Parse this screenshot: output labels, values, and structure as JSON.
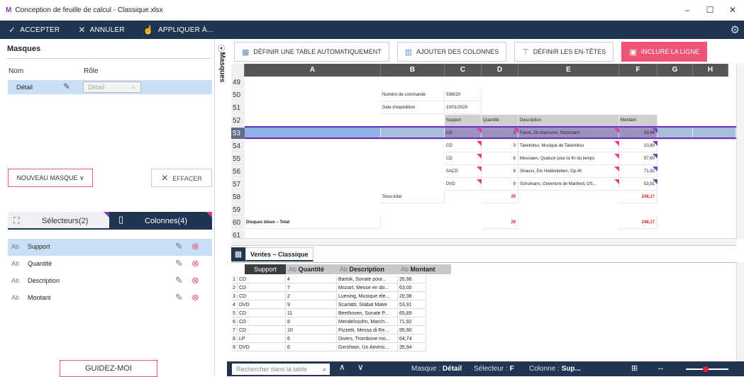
{
  "window": {
    "title": "Conception de feuille de calcul - Classique.xlsx",
    "logo": "M",
    "minimize": "–",
    "maximize": "☐",
    "close": "✕"
  },
  "toolbar": {
    "accept": "ACCEPTER",
    "cancel": "ANNULER",
    "apply": "APPLIQUER À..."
  },
  "masks": {
    "title": "Masques",
    "col_name": "Nom",
    "col_role": "Rôle",
    "rows": [
      {
        "name": "Détail",
        "role": "Détail"
      }
    ],
    "new_button": "NOUVEAU MASQUE ∨",
    "clear_button": "EFFACER",
    "vertical_label": "Masques"
  },
  "tabs": {
    "selectors": "Sélecteurs(2)",
    "columns": "Colonnes(4)"
  },
  "columns_list": [
    {
      "type": "Ab",
      "name": "Support"
    },
    {
      "type": "Ab",
      "name": "Quantité"
    },
    {
      "type": "Ab",
      "name": "Description"
    },
    {
      "type": "Ab",
      "name": "Montant"
    }
  ],
  "guide_button": "GUIDEZ-MOI",
  "sheet_toolbar": {
    "auto_table": "DÉFINIR UNE TABLE AUTOMATIQUEMENT",
    "add_columns": "AJOUTER DES COLONNES",
    "headers": "DÉFINIR LES EN-TÊTES",
    "include_row": "INCLURE LA LIGNE"
  },
  "grid": {
    "columns": [
      "A",
      "B",
      "C",
      "D",
      "E",
      "F",
      "G",
      "H"
    ],
    "rows": [
      "49",
      "50",
      "51",
      "52",
      "53",
      "54",
      "55",
      "56",
      "57",
      "58",
      "59",
      "60",
      "61"
    ],
    "active_row": "53",
    "cells": {
      "order_label": "Numéro de commande",
      "order_value": "536020",
      "ship_label": "Date d'expédition",
      "ship_value": "10/01/2020",
      "h_support": "Support",
      "h_qty": "Quantité",
      "h_desc": "Description",
      "h_amount": "Montant",
      "r53": [
        "CD",
        "3",
        "Faure, 28 chansons, Stulzmann",
        "53,94"
      ],
      "r54": [
        "CD",
        "3",
        "Takemitsu, Musique de Takemitsu",
        "10,80"
      ],
      "r55": [
        "CD",
        "6",
        "Messiaen, Quatuor pour la fin du temps",
        "57,60"
      ],
      "r56": [
        "SACD",
        "8",
        "Strauss, Ein Heldenleben, Op.40",
        "71,92"
      ],
      "r57": [
        "DVD",
        "9",
        "Schumann, Ouverture de Manfred, OS...",
        "53,91"
      ],
      "subtotal_label": "Sous-total",
      "subtotal_qty": "29",
      "subtotal_amount": "248,17",
      "total_label": "Disques bleus – Total",
      "total_qty": "29",
      "total_amount": "248,17"
    }
  },
  "sheet_tab": "Ventes – Classique",
  "preview": {
    "headers": [
      "Support",
      "Quantité",
      "Description",
      "Montant"
    ],
    "header_types": [
      "",
      "Ab",
      "Ab",
      "Ab"
    ],
    "rows": [
      [
        "1",
        "CD",
        "4",
        "Bartok, Sonate pour...",
        "35,96"
      ],
      [
        "2",
        "CD",
        "7",
        "Mozart, Messe en do...",
        "63,00"
      ],
      [
        "3",
        "CD",
        "2",
        "Luening, Musique éle...",
        "20,38"
      ],
      [
        "4",
        "DVD",
        "9",
        "Scarlatti, Stabat Mater",
        "53,91"
      ],
      [
        "5",
        "CD",
        "11",
        "Beethoven, Sonate P...",
        "65,89"
      ],
      [
        "6",
        "CD",
        "8",
        "Mendelssohn, March...",
        "71,92"
      ],
      [
        "7",
        "CD",
        "10",
        "Pizzetti, Messa di Re...",
        "95,90"
      ],
      [
        "8",
        "LP",
        "6",
        "Divers, Trombone mo...",
        "64,74"
      ],
      [
        "9",
        "DVD",
        "6",
        "Gershwin, Un Améric...",
        "35,94"
      ]
    ]
  },
  "status": {
    "search_placeholder": "Rechercher dans la table",
    "mask_label": "Masque :",
    "mask_value": "Détail",
    "selector_label": "Sélecteur :",
    "selector_value": "F",
    "column_label": "Colonne :",
    "column_value": "Sup..."
  }
}
